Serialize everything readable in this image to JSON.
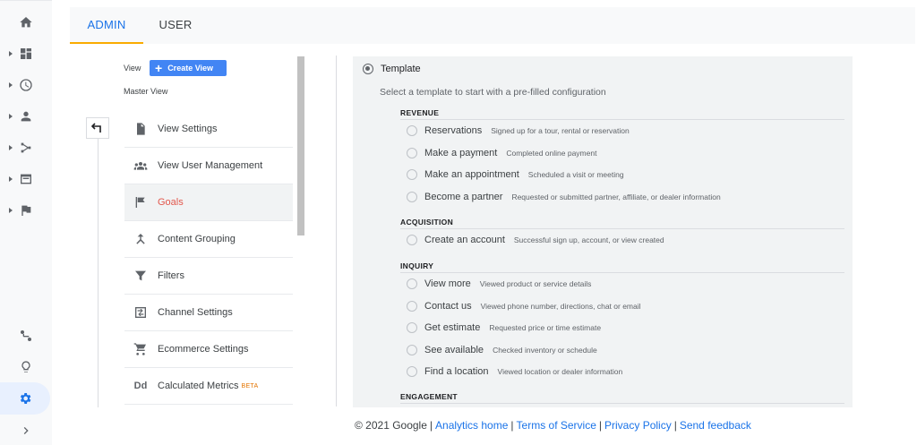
{
  "tabs": {
    "admin": "ADMIN",
    "user": "USER"
  },
  "view": {
    "label": "View",
    "create_button": "Create View",
    "name": "Master View"
  },
  "menu": [
    {
      "label": "View Settings",
      "icon": "document-icon"
    },
    {
      "label": "View User Management",
      "icon": "people-icon"
    },
    {
      "label": "Goals",
      "icon": "flag-icon"
    },
    {
      "label": "Content Grouping",
      "icon": "merge-icon"
    },
    {
      "label": "Filters",
      "icon": "filter-icon"
    },
    {
      "label": "Channel Settings",
      "icon": "channel-icon"
    },
    {
      "label": "Ecommerce Settings",
      "icon": "cart-icon"
    },
    {
      "label": "Calculated Metrics",
      "icon": "dd-icon",
      "badge": "BETA",
      "icon_text": "Dd"
    }
  ],
  "template": {
    "option_label": "Template",
    "subtitle": "Select a template to start with a pre-filled configuration",
    "sections": [
      {
        "title": "REVENUE",
        "options": [
          {
            "name": "Reservations",
            "desc": "Signed up for a tour, rental or reservation"
          },
          {
            "name": "Make a payment",
            "desc": "Completed online payment"
          },
          {
            "name": "Make an appointment",
            "desc": "Scheduled a visit or meeting"
          },
          {
            "name": "Become a partner",
            "desc": "Requested or submitted partner, affiliate, or dealer information"
          }
        ]
      },
      {
        "title": "ACQUISITION",
        "options": [
          {
            "name": "Create an account",
            "desc": "Successful sign up, account, or view created"
          }
        ]
      },
      {
        "title": "INQUIRY",
        "options": [
          {
            "name": "View more",
            "desc": "Viewed product or service details"
          },
          {
            "name": "Contact us",
            "desc": "Viewed phone number, directions, chat or email"
          },
          {
            "name": "Get estimate",
            "desc": "Requested price or time estimate"
          },
          {
            "name": "See available",
            "desc": "Checked inventory or schedule"
          },
          {
            "name": "Find a location",
            "desc": "Viewed location or dealer information"
          }
        ]
      },
      {
        "title": "ENGAGEMENT",
        "options": []
      }
    ]
  },
  "footer": {
    "copyright": "© 2021 Google",
    "links": [
      "Analytics home",
      "Terms of Service",
      "Privacy Policy",
      "Send feedback"
    ]
  },
  "colors": {
    "accent": "#1a73e8",
    "tab_underline": "#f9ab00",
    "active_goal": "#e2574c",
    "button": "#4285f4"
  }
}
